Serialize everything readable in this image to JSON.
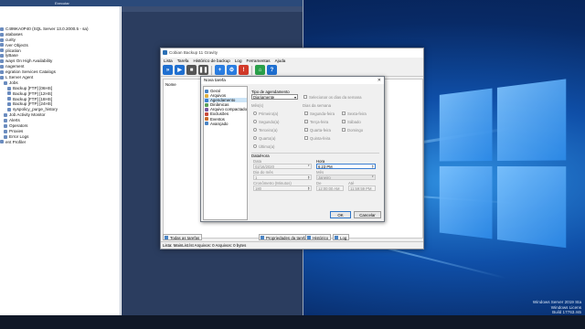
{
  "ssms": {
    "title": "Executar",
    "tree": [
      "C499KA0P40 (SQL Server 13.0.2000.5 - sa)",
      "atabases",
      "curity",
      "rver Objects",
      "plication",
      "lyBase",
      "ways On High Availability",
      "nagement",
      "egration Services Catalogs",
      "L Server Agent",
      "Jobs",
      "Backup [FTP] [06HS]",
      "Backup [FTP] [12HS]",
      "Backup [FTP] [18HS]",
      "Backup [FTP] [24HS]",
      "syspolicy_purge_history",
      "Job Activity Monitor",
      "Alerts",
      "Operators",
      "Proxies",
      "Error Logs",
      "ent Profiler"
    ]
  },
  "cobian": {
    "title": "Cobian Backup 11 Gravity",
    "menu": [
      "Lista",
      "Tarefa",
      "Histórico de backup",
      "Log",
      "Ferramentas",
      "Ajuda"
    ],
    "column_nome": "Nome",
    "tabs": [
      "Todas as tarefas",
      "Propriedades da tarefa",
      "Histórico",
      "Log"
    ],
    "status": "Lista: MainList.lst    Arquivos: 0    Arquivos: 0 bytes"
  },
  "dialog": {
    "title": "Nova tarefa",
    "nav": [
      "Geral",
      "Arquivos",
      "Agendamento",
      "Dinâmicas",
      "Arquivo compactado",
      "Exclusões",
      "Eventos",
      "Avançado"
    ],
    "nav_selected": 2,
    "tipo_label": "Tipo de agendamento",
    "tipo_value": "Diariamente",
    "selecionar_dias_label": "Selecionar os dias da semana",
    "mes_label": "Mês(s)",
    "meses": [
      "Primeiro(a)",
      "Segundo(a)",
      "Terceiro(a)",
      "Quarto(a)",
      "Último(a)"
    ],
    "dias_label": "Dias da semana",
    "dias_col1": [
      "Segunda-feira",
      "Terça-feira",
      "Quarta-feira",
      "Quinta-feira"
    ],
    "dias_col2": [
      "Sexta-feira",
      "Sábado",
      "Domingo"
    ],
    "datahora_label": "Data/Hora",
    "data_label": "Data",
    "data_value": "02/16/2020",
    "hora_label": "Hora",
    "hora_value": "6:23 PM",
    "dia_mes_label": "Dia do mês",
    "dia_mes_value": "1",
    "mes_field_label": "Mês",
    "mes_field_value": "Janeiro",
    "cronometro_label": "Cronômetro (Minutos)",
    "cronometro_value": "180",
    "de_label": "De",
    "de_value": "12:00:00 AM",
    "ate_label": "Até",
    "ate_value": "11:59:59 PM",
    "ok_label": "OK",
    "cancelar_label": "Cancelar"
  },
  "desktop": {
    "os_lines": [
      "Windows Server 2019 Sta",
      "Windows Licens",
      "Build 17763.rs5"
    ]
  },
  "icons": {
    "toolbar": [
      "run-all-icon",
      "run-icon",
      "stop-icon",
      "pause-icon",
      "add-task-icon",
      "settings-icon",
      "delete-icon",
      "home-icon",
      "help-icon"
    ]
  },
  "colors": {
    "selection": "#cce4f7",
    "focus": "#3c7fd1",
    "toolbar_blue": "#1f6fd0"
  }
}
